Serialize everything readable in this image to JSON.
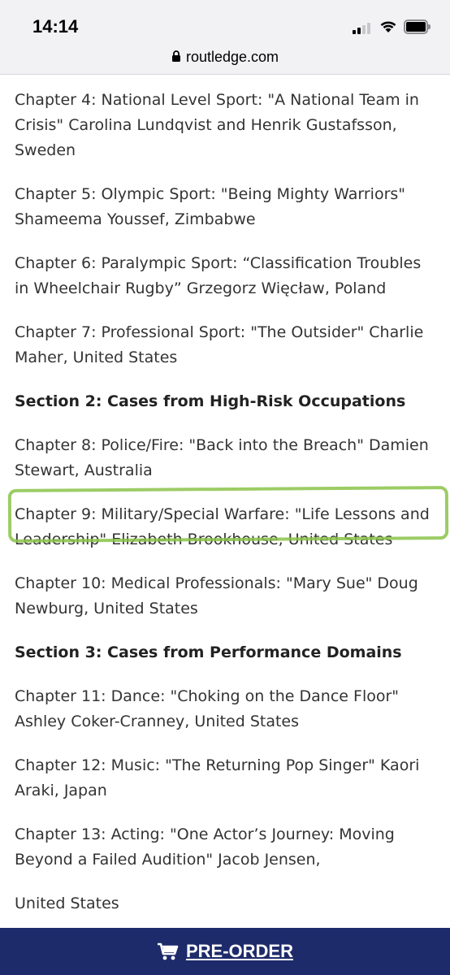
{
  "status_bar": {
    "time": "14:14"
  },
  "browser": {
    "url": "routledge.com"
  },
  "content": {
    "items": [
      {
        "text": "Chapter 4: National Level Sport: \"A National Team in Crisis\" Carolina Lundqvist and Henrik Gustafsson, Sweden"
      },
      {
        "text": "Chapter 5: Olympic Sport: \"Being Mighty Warriors\" Shameema Youssef, Zimbabwe"
      },
      {
        "text": "Chapter 6: Paralympic Sport: “Classification Troubles in Wheelchair Rugby” Grzegorz Więcław, Poland"
      },
      {
        "text": "Chapter 7: Professional Sport: \"The Outsider\" Charlie Maher, United States"
      },
      {
        "text": "Section 2: Cases from High-Risk Occupations"
      },
      {
        "text": "Chapter 8: Police/Fire: \"Back into the Breach\" Damien Stewart, Australia"
      },
      {
        "text": "Chapter 9: Military/Special Warfare: \"Life Lessons and Leadership\" Elizabeth Brookhouse, United States"
      },
      {
        "text": "Chapter 10: Medical Professionals: \"Mary Sue\" Doug Newburg, United States"
      },
      {
        "text": "Section 3: Cases from Performance Domains"
      },
      {
        "text": "Chapter 11: Dance: \"Choking on the Dance Floor\" Ashley Coker-Cranney, United States"
      },
      {
        "text": "Chapter 12: Music: \"The Returning Pop Singer\" Kaori Araki, Japan"
      },
      {
        "text": "Chapter 13: Acting: \"One Actor’s Journey: Moving Beyond a Failed Audition\" Jacob Jensen,"
      },
      {
        "text": "United States"
      }
    ]
  },
  "footer": {
    "preorder_label": "PRE-ORDER"
  },
  "colors": {
    "footer_bg": "#1e2b6b",
    "highlight": "#8bc34a"
  }
}
